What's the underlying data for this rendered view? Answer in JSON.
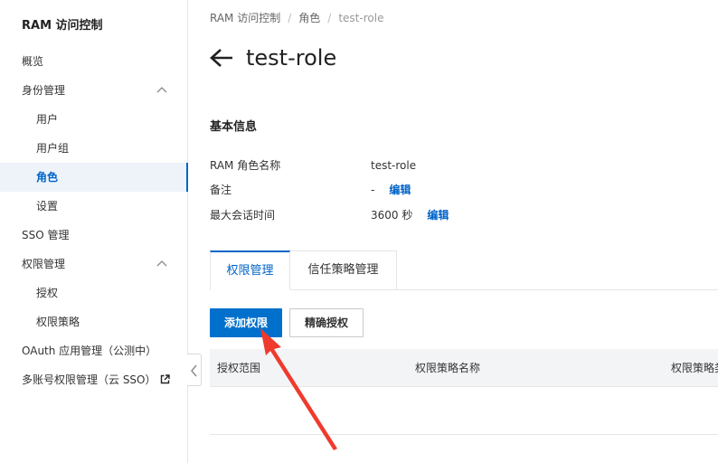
{
  "sidebar": {
    "title": "RAM 访问控制",
    "items": [
      {
        "label": "概览"
      },
      {
        "label": "身份管理"
      },
      {
        "label": "用户"
      },
      {
        "label": "用户组"
      },
      {
        "label": "角色"
      },
      {
        "label": "设置"
      },
      {
        "label": "SSO 管理"
      },
      {
        "label": "权限管理"
      },
      {
        "label": "授权"
      },
      {
        "label": "权限策略"
      },
      {
        "label": "OAuth 应用管理（公测中）"
      },
      {
        "label": "多账号权限管理（云 SSO）"
      }
    ]
  },
  "breadcrumb": {
    "items": [
      "RAM 访问控制",
      "角色",
      "test-role"
    ],
    "separator": "/"
  },
  "page": {
    "title": "test-role"
  },
  "basic_info": {
    "title": "基本信息",
    "rows": [
      {
        "key": "RAM 角色名称",
        "value": "test-role"
      },
      {
        "key": "备注",
        "value": "-",
        "action": "编辑"
      },
      {
        "key": "最大会话时间",
        "value": "3600 秒",
        "action": "编辑"
      }
    ]
  },
  "tabs": {
    "items": [
      "权限管理",
      "信任策略管理"
    ],
    "active": "权限管理"
  },
  "buttons": {
    "add_permission": "添加权限",
    "precise_grant": "精确授权"
  },
  "table": {
    "columns": [
      "授权范围",
      "权限策略名称",
      "权限策略类"
    ]
  },
  "colors": {
    "accent": "#0064c8",
    "primary_button": "#0070cc",
    "annotation_arrow": "#f03a2e"
  }
}
